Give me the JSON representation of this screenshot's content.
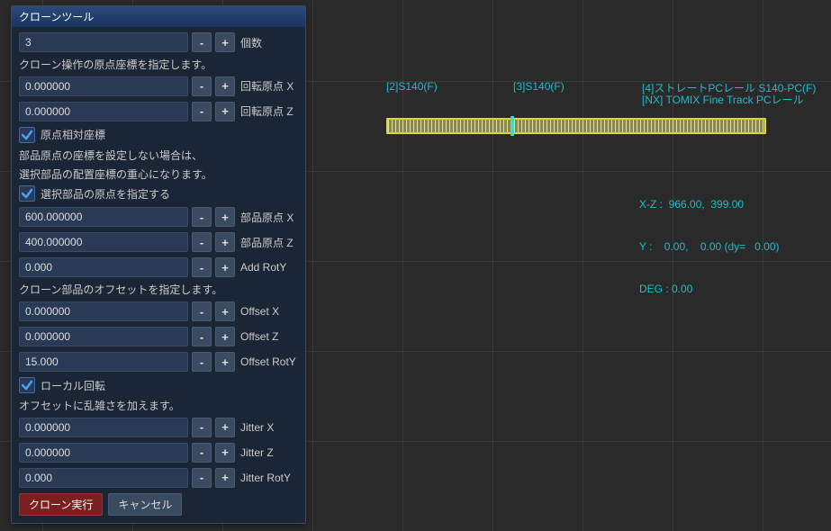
{
  "panel": {
    "title": "クローンツール",
    "count": {
      "value": "3",
      "label": "個数"
    },
    "origin_desc": "クローン操作の原点座標を指定します。",
    "rot_origin_x": {
      "value": "0.000000",
      "label": "回転原点 X"
    },
    "rot_origin_z": {
      "value": "0.000000",
      "label": "回転原点 Z"
    },
    "relative_check": {
      "label": "原点相対座標",
      "checked": true
    },
    "part_origin_desc1": "部品原点の座標を設定しない場合は、",
    "part_origin_desc2": "選択部品の配置座標の重心になります。",
    "part_origin_check": {
      "label": "選択部品の原点を指定する",
      "checked": true
    },
    "part_origin_x": {
      "value": "600.000000",
      "label": "部品原点 X"
    },
    "part_origin_z": {
      "value": "400.000000",
      "label": "部品原点 Z"
    },
    "add_roty": {
      "value": "0.000",
      "label": "Add RotY"
    },
    "offset_desc": "クローン部品のオフセットを指定します。",
    "offset_x": {
      "value": "0.000000",
      "label": "Offset X"
    },
    "offset_z": {
      "value": "0.000000",
      "label": "Offset Z"
    },
    "offset_roty": {
      "value": "15.000",
      "label": "Offset RotY"
    },
    "local_rot_check": {
      "label": "ローカル回転",
      "checked": true
    },
    "jitter_desc": "オフセットに乱雑さを加えます。",
    "jitter_x": {
      "value": "0.000000",
      "label": "Jitter X"
    },
    "jitter_z": {
      "value": "0.000000",
      "label": "Jitter Z"
    },
    "jitter_roty": {
      "value": "0.000",
      "label": "Jitter RotY"
    },
    "exec_label": "クローン実行",
    "cancel_label": "キャンセル"
  },
  "viewport": {
    "label2": "[2]S140(F)",
    "label3": "[3]S140(F)",
    "label4a": "[4]ストレートPCレール S140-PC(F)",
    "label4b": "[NX] TOMIX Fine Track PCレール",
    "status_xz": "X-Z :  966.00,  399.00",
    "status_y": "Y :    0.00,    0.00 (dy=   0.00)",
    "status_deg": "DEG : 0.00"
  }
}
